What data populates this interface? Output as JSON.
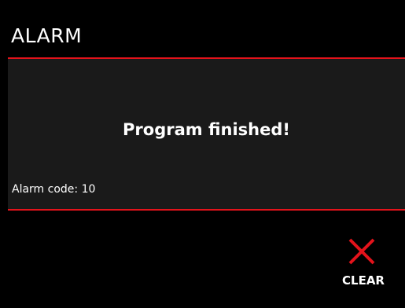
{
  "header": {
    "title": "ALARM"
  },
  "alarm": {
    "message": "Program finished!",
    "code_text": "Alarm code: 10"
  },
  "actions": {
    "clear": {
      "label": "CLEAR",
      "icon": "close-icon"
    }
  },
  "colors": {
    "accent": "#e3131b",
    "background": "#000000",
    "panel": "#1a1a1a",
    "text": "#ffffff"
  }
}
